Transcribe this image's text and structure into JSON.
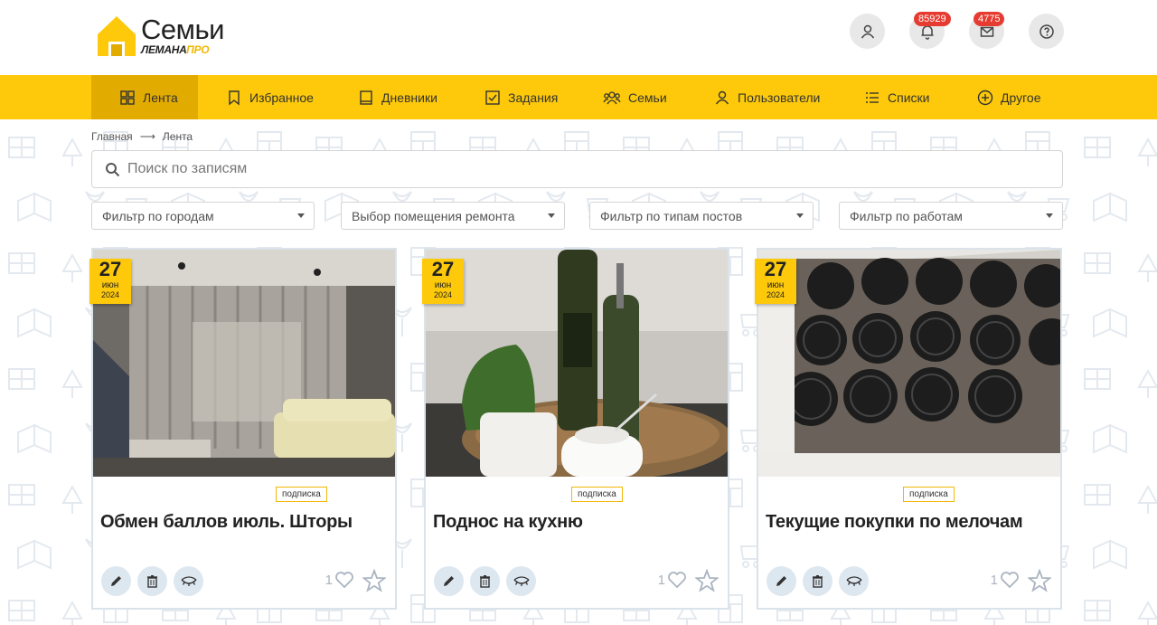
{
  "brand": {
    "name": "Семьи",
    "sub_part1": "ЛЕМАНА",
    "sub_part2": "ПРО",
    "accent": "#fdc90a",
    "accent_dark": "#e2ab00",
    "badge_color": "#e53b31"
  },
  "header": {
    "profile_icon": "user-icon",
    "notifications": {
      "icon": "bell-icon",
      "count": "85929"
    },
    "messages": {
      "icon": "mail-icon",
      "count": "4775"
    },
    "help_icon": "question-icon"
  },
  "nav": {
    "items": [
      {
        "label": "Лента",
        "icon": "grid-icon",
        "active": true
      },
      {
        "label": "Избранное",
        "icon": "bookmark-icon",
        "active": false
      },
      {
        "label": "Дневники",
        "icon": "book-icon",
        "active": false
      },
      {
        "label": "Задания",
        "icon": "checkbox-icon",
        "active": false
      },
      {
        "label": "Семьи",
        "icon": "people-icon",
        "active": false
      },
      {
        "label": "Пользователи",
        "icon": "user-icon",
        "active": false
      },
      {
        "label": "Списки",
        "icon": "list-icon",
        "active": false
      },
      {
        "label": "Другое",
        "icon": "plus-circle-icon",
        "active": false
      }
    ]
  },
  "breadcrumb": {
    "home": "Главная",
    "current": "Лента"
  },
  "search": {
    "placeholder": "Поиск по записям"
  },
  "filters": [
    {
      "placeholder": "Фильтр по городам"
    },
    {
      "placeholder": "Выбор помещения ремонта"
    },
    {
      "placeholder": "Фильтр по типам постов"
    },
    {
      "placeholder": "Фильтр по работам"
    }
  ],
  "cards": [
    {
      "day": "27",
      "month": "июн",
      "year": "2024",
      "tag": "подписка",
      "title": "Обмен баллов июль. Шторы",
      "likes": "1",
      "image": "living-room-curtains"
    },
    {
      "day": "27",
      "month": "июн",
      "year": "2024",
      "tag": "подписка",
      "title": "Поднос на кухню",
      "likes": "1",
      "image": "kitchen-tray-bottles"
    },
    {
      "day": "27",
      "month": "июн",
      "year": "2024",
      "tag": "подписка",
      "title": "Текущие покупки по мелочам",
      "likes": "1",
      "image": "spice-jars-drawer"
    }
  ]
}
